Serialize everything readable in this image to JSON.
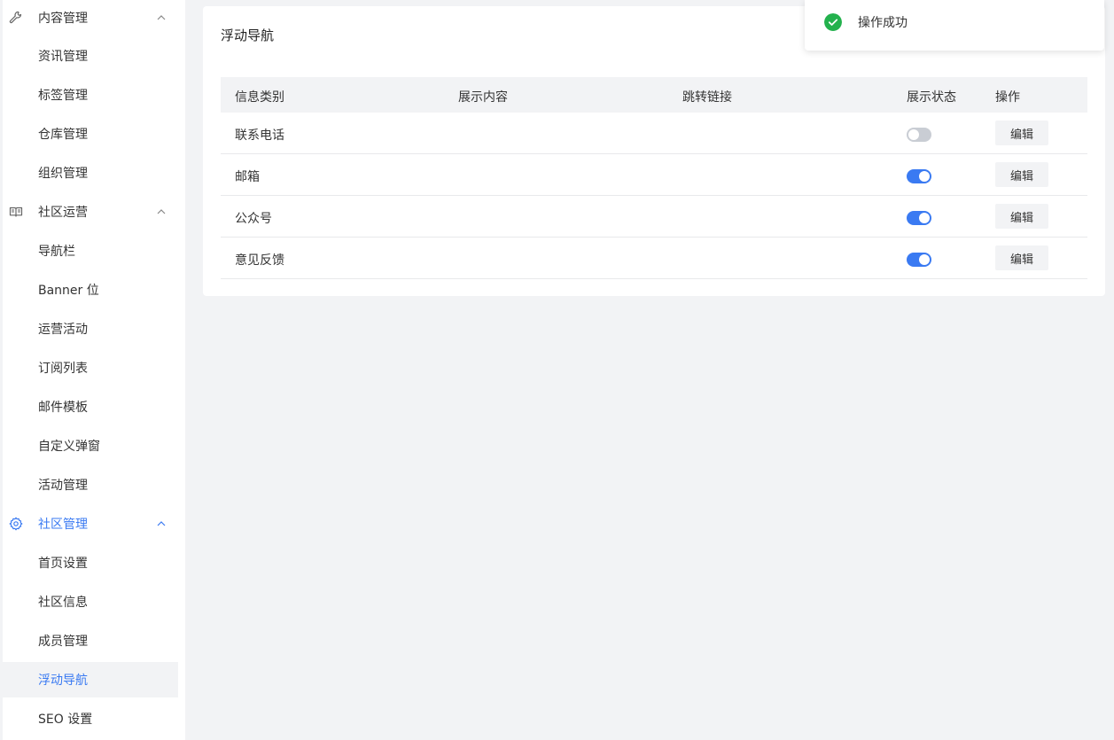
{
  "sidebar": {
    "groups": [
      {
        "label": "内容管理",
        "icon": "wrench-icon",
        "items": [
          "资讯管理",
          "标签管理",
          "仓库管理",
          "组织管理"
        ]
      },
      {
        "label": "社区运营",
        "icon": "book-icon",
        "items": [
          "导航栏",
          "Banner 位",
          "运营活动",
          "订阅列表",
          "邮件模板",
          "自定义弹窗",
          "活动管理"
        ]
      },
      {
        "label": "社区管理",
        "icon": "gear-icon",
        "items": [
          "首页设置",
          "社区信息",
          "成员管理",
          "浮动导航",
          "SEO 设置"
        ]
      }
    ],
    "selected_item": "浮动导航"
  },
  "main": {
    "title": "浮动导航",
    "table": {
      "columns": [
        "信息类别",
        "展示内容",
        "跳转链接",
        "展示状态",
        "操作"
      ],
      "rows": [
        {
          "category": "联系电话",
          "content": "",
          "link": "",
          "status": false,
          "action": "编辑"
        },
        {
          "category": "邮箱",
          "content": "",
          "link": "",
          "status": true,
          "action": "编辑"
        },
        {
          "category": "公众号",
          "content": "",
          "link": "",
          "status": true,
          "action": "编辑"
        },
        {
          "category": "意见反馈",
          "content": "",
          "link": "",
          "status": true,
          "action": "编辑"
        }
      ]
    }
  },
  "toast": {
    "message": "操作成功",
    "icon": "check-circle-icon"
  },
  "colors": {
    "accent": "#3a7af2",
    "success": "#23b14d",
    "background": "#f2f3f5"
  }
}
